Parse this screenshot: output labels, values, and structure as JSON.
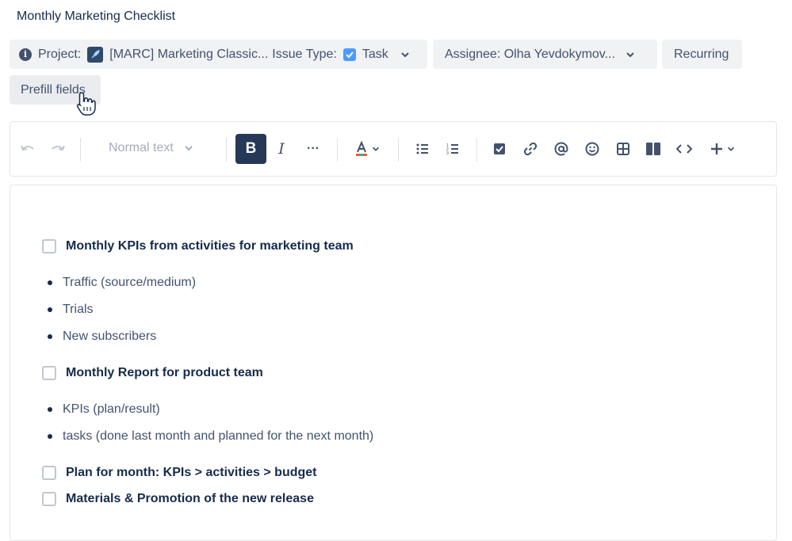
{
  "page_title": "Monthly Marketing Checklist",
  "fields": {
    "project_label": "Project:",
    "project_value": "[MARC] Marketing Classic...",
    "issue_type_label": "Issue Type:",
    "issue_type_value": "Task",
    "assignee": "Assignee: Olha Yevdokymov...",
    "recurring": "Recurring",
    "prefill": "Prefill fields"
  },
  "toolbar": {
    "text_style": "Normal text",
    "bold": "B",
    "italic": "I",
    "more": "···"
  },
  "content": {
    "task1": "Monthly KPIs from activities for marketing team",
    "task1_bullets": [
      "Traffic (source/medium)",
      "Trials",
      "New subscribers"
    ],
    "task2": "Monthly Report for product team",
    "task2_bullets": [
      "KPIs (plan/result)",
      "tasks (done last month and planned for the next month)"
    ],
    "task3": "Plan for month: KPIs > activities > budget",
    "task4": "Materials & Promotion of the new release"
  },
  "colors": {
    "bold_button_bg": "#253858",
    "task_icon": "#4c9aff",
    "chip_bg": "#f1f2f4"
  }
}
